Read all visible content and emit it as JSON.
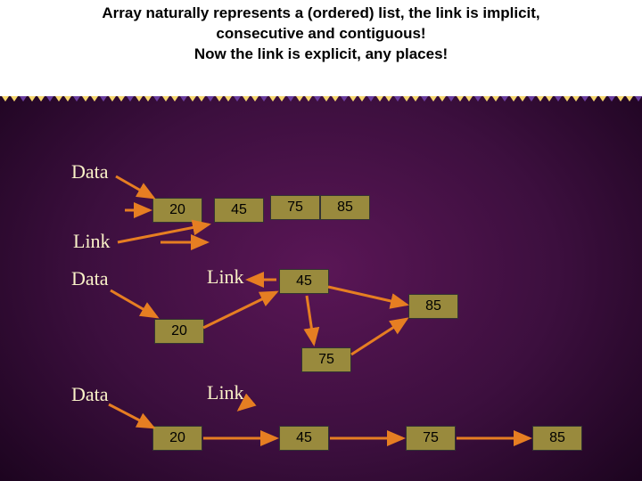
{
  "header": {
    "line1": "Array  naturally represents a (ordered) list, the link is implicit,",
    "line2": "consecutive and contiguous!",
    "line3": "Now the link is explicit, any places!"
  },
  "labels": {
    "data1": "Data",
    "link1": "Link",
    "data2": "Data",
    "link2": "Link",
    "data3": "Data",
    "link3": "Link"
  },
  "row1": {
    "c20": "20",
    "c45": "45",
    "c75": "75",
    "c85": "85"
  },
  "row2": {
    "c20": "20",
    "c45": "45",
    "c75": "75",
    "c85": "85"
  },
  "row3": {
    "c20": "20",
    "c45": "45",
    "c75": "75",
    "c85": "85"
  }
}
